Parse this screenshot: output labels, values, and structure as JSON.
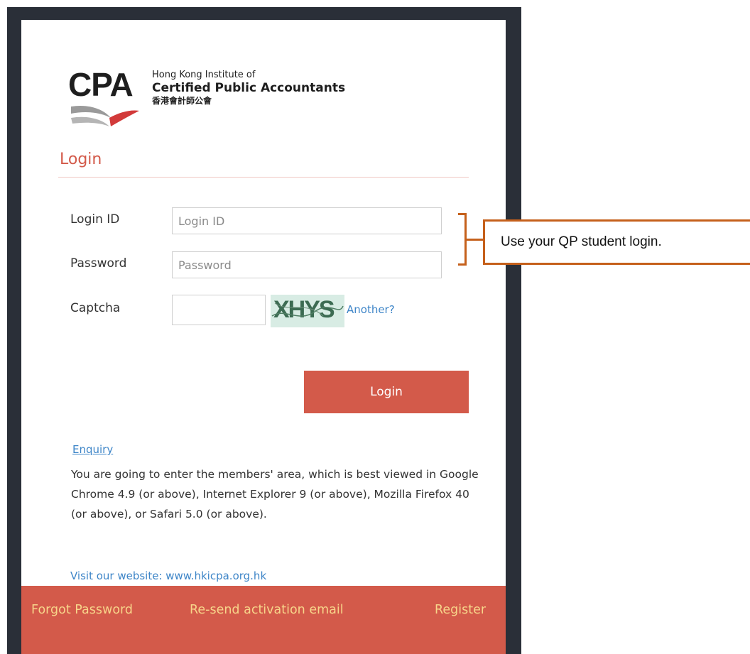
{
  "branding": {
    "logo_mark": "CPA",
    "org_line1": "Hong Kong Institute of",
    "org_line2": "Certified Public Accountants",
    "org_line3": "香港會計師公會"
  },
  "login": {
    "heading": "Login",
    "fields": {
      "login_id": {
        "label": "Login ID",
        "placeholder": "Login ID",
        "value": ""
      },
      "password": {
        "label": "Password",
        "placeholder": "Password",
        "value": ""
      },
      "captcha": {
        "label": "Captcha",
        "value": "",
        "image_text": "XHYS",
        "another_label": "Another?"
      }
    },
    "submit_label": "Login"
  },
  "info": {
    "enquiry_label": "Enquiry",
    "notice": "You are going to enter the members' area, which is best viewed in Google Chrome 4.9 (or above), Internet Explorer 9 (or above), Mozilla Firefox 40 (or above), or Safari 5.0 (or above).",
    "website_label": "Visit our website: www.hkicpa.org.hk"
  },
  "footer": {
    "forgot_password": "Forgot Password",
    "resend_activation": "Re-send activation email",
    "register": "Register"
  },
  "annotation": {
    "callout_text": "Use your QP student login."
  },
  "colors": {
    "brand_red": "#d35a4a",
    "footer_link": "#f7d58a",
    "link_blue": "#3f86c8",
    "callout_orange": "#c5601b",
    "frame_dark": "#2a2f38"
  }
}
